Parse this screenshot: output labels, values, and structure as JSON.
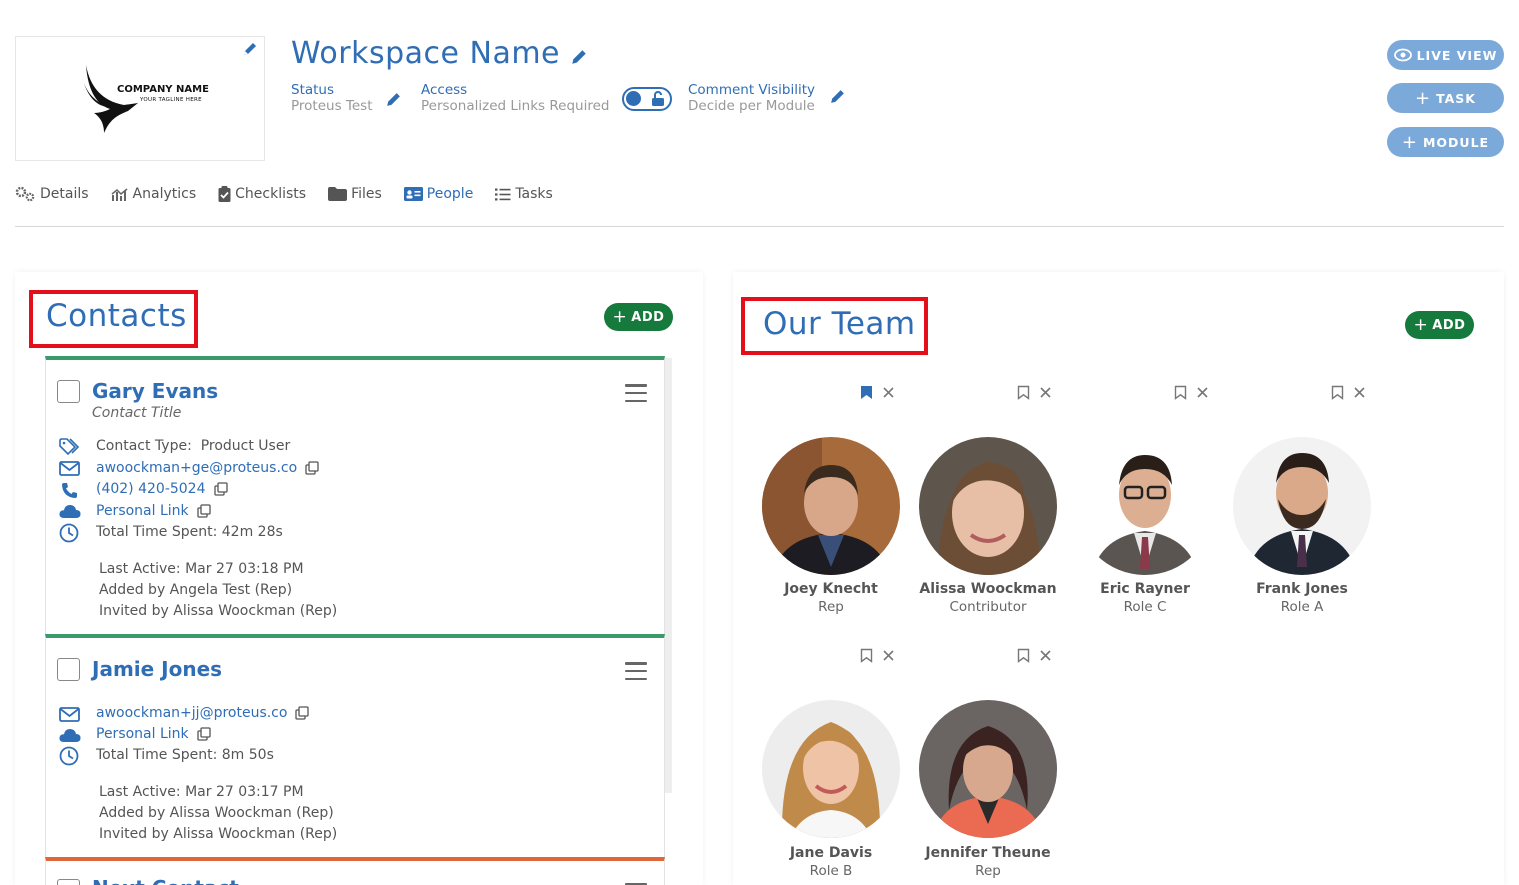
{
  "header": {
    "logo": {
      "company_name": "COMPANY NAME",
      "tagline": "YOUR TAGLINE HERE"
    },
    "workspace_title": "Workspace Name",
    "status": {
      "label": "Status",
      "value": "Proteus Test"
    },
    "access": {
      "label": "Access",
      "value": "Personalized Links Required"
    },
    "comment_visibility": {
      "label": "Comment Visibility",
      "value": "Decide per Module"
    },
    "buttons": {
      "live_view": "LIVE VIEW",
      "task": "TASK",
      "module": "MODULE"
    }
  },
  "tabs": [
    {
      "label": "Details",
      "icon": "gears-icon"
    },
    {
      "label": "Analytics",
      "icon": "analytics-icon"
    },
    {
      "label": "Checklists",
      "icon": "clipboard-check-icon"
    },
    {
      "label": "Files",
      "icon": "folder-icon"
    },
    {
      "label": "People",
      "icon": "id-card-icon",
      "active": true
    },
    {
      "label": "Tasks",
      "icon": "list-icon"
    }
  ],
  "contacts": {
    "title": "Contacts",
    "add_label": "ADD",
    "items": [
      {
        "name": "Gary Evans",
        "title": "Contact Title",
        "contact_type_label": "Contact Type:",
        "contact_type": "Product User",
        "email": "awoockman+ge@proteus.co",
        "phone": "(402) 420-5024",
        "personal_link": "Personal Link",
        "total_time": "Total Time Spent: 42m 28s",
        "last_active": "Last Active: Mar 27 03:18 PM",
        "added_by": "Added by Angela Test (Rep)",
        "invited_by": "Invited by Alissa Woockman (Rep)",
        "accent": "#3a9a6a"
      },
      {
        "name": "Jamie Jones",
        "email": "awoockman+jj@proteus.co",
        "personal_link": "Personal Link",
        "total_time": "Total Time Spent: 8m 50s",
        "last_active": "Last Active: Mar 27 03:17 PM",
        "added_by": "Added by Alissa Woockman (Rep)",
        "invited_by": "Invited by Alissa Woockman (Rep)",
        "accent": "#3a9a6a"
      },
      {
        "name": "Next Contact",
        "accent": "#e0663a"
      }
    ]
  },
  "team": {
    "title": "Our Team",
    "add_label": "ADD",
    "members": [
      {
        "name": "Joey Knecht",
        "role": "Rep",
        "bookmarked": true
      },
      {
        "name": "Alissa Woockman",
        "role": "Contributor",
        "bookmarked": false
      },
      {
        "name": "Eric Rayner",
        "role": "Role C",
        "bookmarked": false
      },
      {
        "name": "Frank Jones",
        "role": "Role A",
        "bookmarked": false
      },
      {
        "name": "Jane Davis",
        "role": "Role B",
        "bookmarked": false
      },
      {
        "name": "Jennifer Theune",
        "role": "Rep",
        "bookmarked": false
      }
    ]
  },
  "colors": {
    "brand_blue": "#2f6db5",
    "add_green": "#157a3c",
    "pill_blue": "#7ba9da",
    "highlight_red": "#e3101c"
  }
}
